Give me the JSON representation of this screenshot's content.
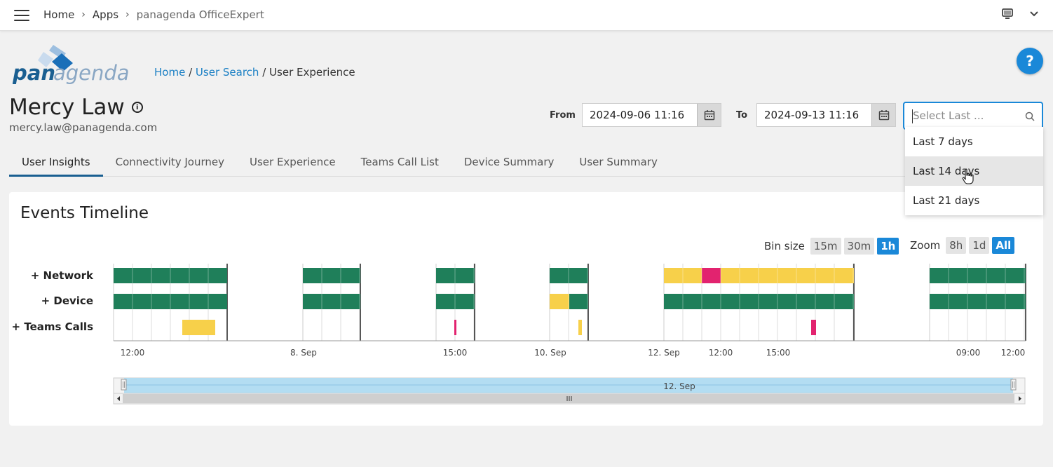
{
  "topbar": {
    "crumbs": [
      "Home",
      "Apps",
      "panagenda OfficeExpert"
    ],
    "separator": "›"
  },
  "logo": {
    "text": "panagenda"
  },
  "breadcrumb": {
    "home": "Home",
    "user_search": "User Search",
    "current": "User Experience",
    "sep": "/"
  },
  "help": {
    "label": "?"
  },
  "user": {
    "name": "Mercy Law",
    "email": "mercy.law@panagenda.com"
  },
  "date_range": {
    "from_label": "From",
    "from_value": "2024-09-06 11:16",
    "to_label": "To",
    "to_value": "2024-09-13 11:16"
  },
  "select_last": {
    "placeholder": "Select Last ...",
    "options": [
      "Last 7 days",
      "Last 14 days",
      "Last 21 days"
    ],
    "hovered_index": 1
  },
  "tabs": [
    "User Insights",
    "Connectivity Journey",
    "User Experience",
    "Teams Call List",
    "Device Summary",
    "User Summary"
  ],
  "active_tab": 0,
  "timeline": {
    "title": "Events Timeline",
    "bin_size_label": "Bin size",
    "bin_sizes": [
      "15m",
      "30m",
      "1h"
    ],
    "bin_active": "1h",
    "zoom_label": "Zoom",
    "zooms": [
      "8h",
      "1d",
      "All"
    ],
    "zoom_active": "All",
    "rows": [
      "+ Network",
      "+ Device",
      "+ Teams Calls"
    ],
    "x_ticks": [
      "12:00",
      "8. Sep",
      "15:00",
      "10. Sep",
      "12. Sep",
      "12:00",
      "15:00",
      "09:00",
      "12:00"
    ],
    "navigator_label": "12. Sep",
    "colors": {
      "good": "#1f7f5a",
      "warn": "#f7d04a",
      "bad": "#e2236f",
      "nav": "#b3ddf2"
    }
  }
}
